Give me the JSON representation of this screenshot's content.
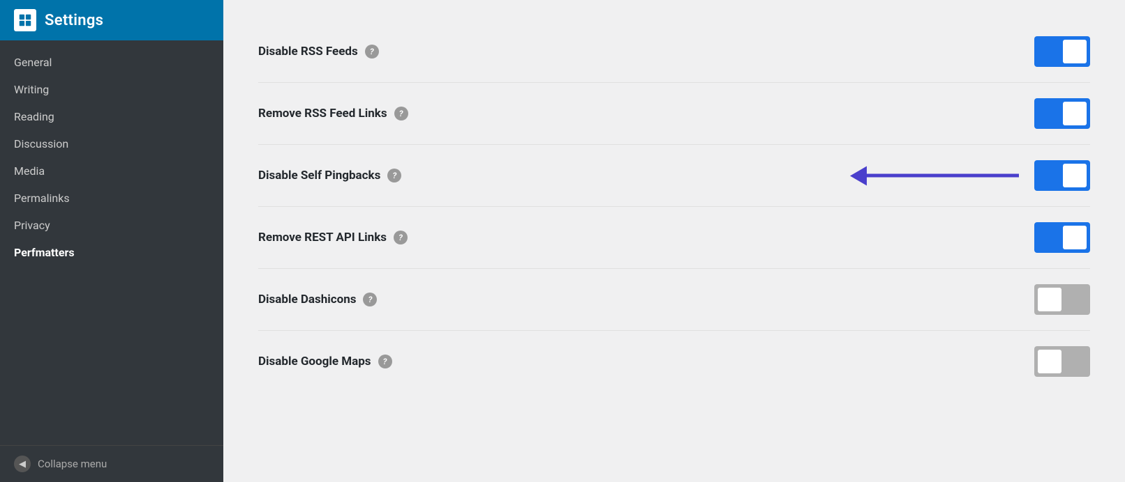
{
  "sidebar": {
    "header": {
      "title": "Settings",
      "logo_alt": "WordPress logo"
    },
    "nav_items": [
      {
        "id": "general",
        "label": "General",
        "active": false
      },
      {
        "id": "writing",
        "label": "Writing",
        "active": false
      },
      {
        "id": "reading",
        "label": "Reading",
        "active": false
      },
      {
        "id": "discussion",
        "label": "Discussion",
        "active": false
      },
      {
        "id": "media",
        "label": "Media",
        "active": false
      },
      {
        "id": "permalinks",
        "label": "Permalinks",
        "active": false
      },
      {
        "id": "privacy",
        "label": "Privacy",
        "active": false
      },
      {
        "id": "perfmatters",
        "label": "Perfmatters",
        "active": true
      }
    ],
    "collapse_label": "Collapse menu"
  },
  "main": {
    "settings": [
      {
        "id": "disable-rss-feeds",
        "label": "Disable RSS Feeds",
        "state": "on",
        "has_arrow": false
      },
      {
        "id": "remove-rss-feed-links",
        "label": "Remove RSS Feed Links",
        "state": "on",
        "has_arrow": false
      },
      {
        "id": "disable-self-pingbacks",
        "label": "Disable Self Pingbacks",
        "state": "on",
        "has_arrow": true
      },
      {
        "id": "remove-rest-api-links",
        "label": "Remove REST API Links",
        "state": "on",
        "has_arrow": false
      },
      {
        "id": "disable-dashicons",
        "label": "Disable Dashicons",
        "state": "off",
        "has_arrow": false
      },
      {
        "id": "disable-google-maps",
        "label": "Disable Google Maps",
        "state": "off",
        "has_arrow": false
      }
    ],
    "help_icon_label": "?"
  }
}
